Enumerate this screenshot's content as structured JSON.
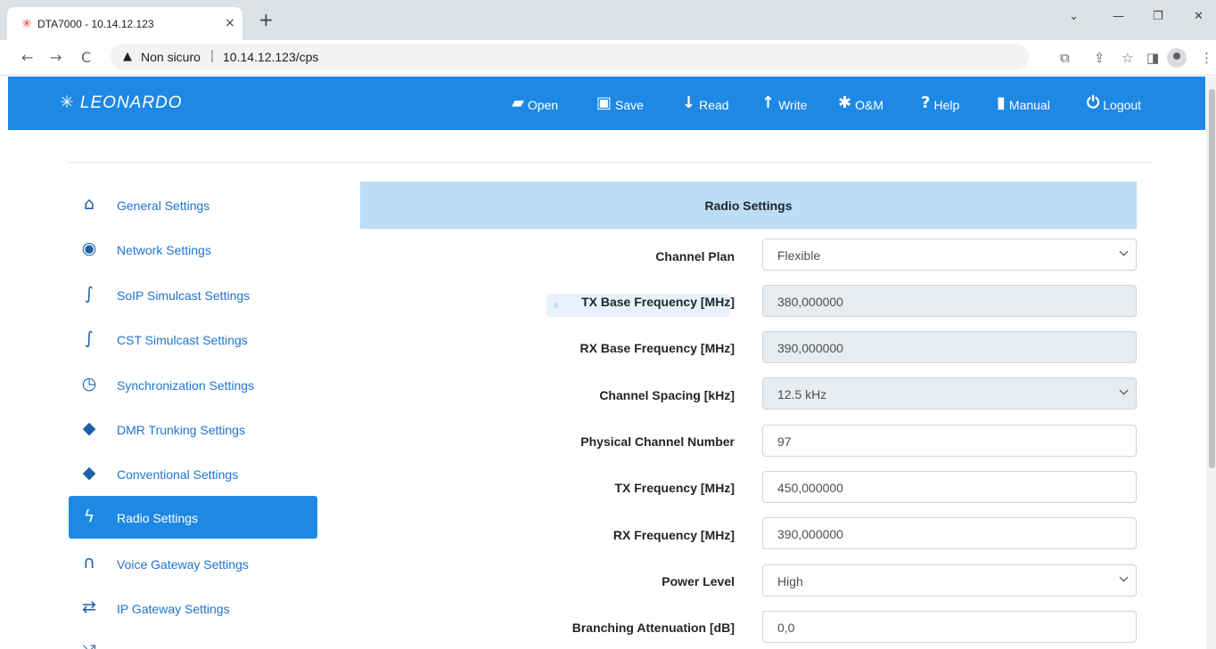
{
  "browser": {
    "tab_title": "DTA7000 - 10.14.12.123",
    "tab_close": "×",
    "new_tab": "+",
    "win_minimize": "—",
    "win_restore": "❐",
    "win_close": "✕",
    "win_dropdown": "⌄",
    "nav_back": "←",
    "nav_forward": "→",
    "nav_reload": "C",
    "security_icon": "▲",
    "security_status": "Non sicuro",
    "url_sep": "|",
    "url": "10.14.12.123/cps",
    "icon_translate": "⧉",
    "icon_share": "⇪",
    "icon_star": "☆",
    "icon_sidepanel": "◨",
    "icon_menu": "⋮"
  },
  "header": {
    "brand": "LEONARDO",
    "brand_mark": "✳",
    "menu": [
      {
        "label": "Open",
        "icon": "folder-open-icon",
        "glyph": "▰"
      },
      {
        "label": "Save",
        "icon": "save-icon",
        "glyph": "▣"
      },
      {
        "label": "Read",
        "icon": "arrow-down-icon",
        "glyph": "↓"
      },
      {
        "label": "Write",
        "icon": "arrow-up-icon",
        "glyph": "↑"
      },
      {
        "label": "O&M",
        "icon": "cog-icon",
        "glyph": "✱"
      },
      {
        "label": "Help",
        "icon": "question-circle-icon",
        "glyph": "?"
      },
      {
        "label": "Manual",
        "icon": "book-icon",
        "glyph": "▮"
      },
      {
        "label": "Logout",
        "icon": "power-icon",
        "glyph": "⏻"
      }
    ]
  },
  "sidebar": {
    "items": [
      {
        "label": "General Settings",
        "icon": "home-icon",
        "glyph": "⌂"
      },
      {
        "label": "Network Settings",
        "icon": "globe-icon",
        "glyph": "◉"
      },
      {
        "label": "SoIP Simulcast Settings",
        "icon": "link-icon",
        "glyph": "∫"
      },
      {
        "label": "CST Simulcast Settings",
        "icon": "link-icon",
        "glyph": "∫"
      },
      {
        "label": "Synchronization Settings",
        "icon": "clock-icon",
        "glyph": "◷"
      },
      {
        "label": "DMR Trunking Settings",
        "icon": "tags-icon",
        "glyph": "◆"
      },
      {
        "label": "Conventional Settings",
        "icon": "tag-icon",
        "glyph": "◆"
      },
      {
        "label": "Radio Settings",
        "icon": "bolt-icon",
        "glyph": "ϟ",
        "active": true
      },
      {
        "label": "Voice Gateway Settings",
        "icon": "headphones-icon",
        "glyph": "∩"
      },
      {
        "label": "IP Gateway Settings",
        "icon": "exchange-icon",
        "glyph": "⇄"
      },
      {
        "label": "",
        "icon": "shuffle-icon",
        "glyph": "⤮"
      }
    ]
  },
  "section": {
    "title": "Radio Settings",
    "fields": [
      {
        "label": "Channel Plan",
        "value": "Flexible",
        "type": "select",
        "disabled": false
      },
      {
        "label": "TX Base Frequency [MHz]",
        "value": "380,000000",
        "type": "input",
        "disabled": true
      },
      {
        "label": "RX Base Frequency [MHz]",
        "value": "390,000000",
        "type": "input",
        "disabled": true
      },
      {
        "label": "Channel Spacing [kHz]",
        "value": "12.5 kHz",
        "type": "select",
        "disabled": true
      },
      {
        "label": "Physical Channel Number",
        "value": "97",
        "type": "input",
        "disabled": false
      },
      {
        "label": "TX Frequency [MHz]",
        "value": "450,000000",
        "type": "input",
        "disabled": false
      },
      {
        "label": "RX Frequency [MHz]",
        "value": "390,000000",
        "type": "input",
        "disabled": false
      },
      {
        "label": "Power Level",
        "value": "High",
        "type": "select",
        "disabled": false
      },
      {
        "label": "Branching Attenuation [dB]",
        "value": "0,0",
        "type": "input",
        "disabled": false
      }
    ]
  },
  "colors": {
    "brand_blue": "#1e88e5",
    "section_header": "#bcddf7",
    "link_blue": "#1e74d0"
  }
}
